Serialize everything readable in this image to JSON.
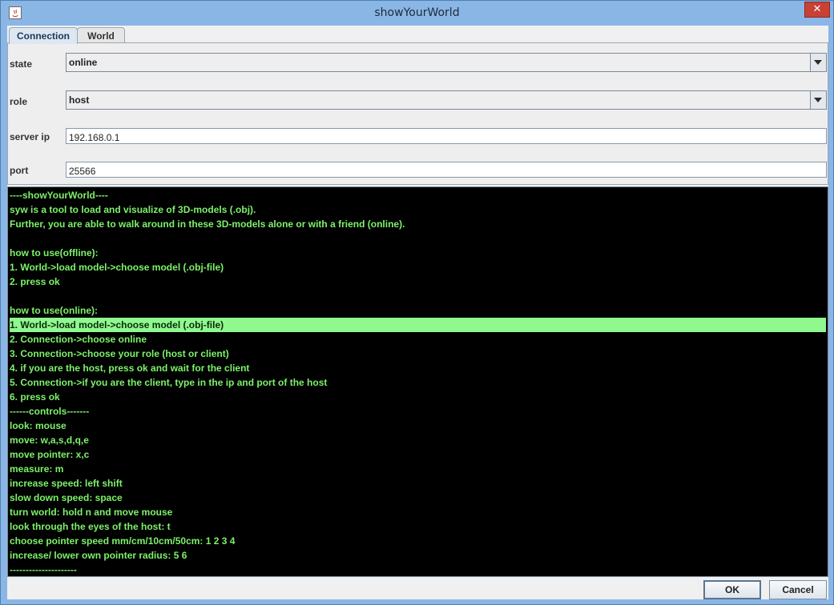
{
  "window": {
    "title": "showYourWorld",
    "close_label": "✕"
  },
  "tabs": [
    {
      "label": "Connection"
    },
    {
      "label": "World"
    }
  ],
  "form": {
    "state": {
      "label": "state",
      "value": "online"
    },
    "role": {
      "label": "role",
      "value": "host"
    },
    "server_ip": {
      "label": "server ip",
      "value": "192.168.0.1"
    },
    "port": {
      "label": "port",
      "value": "25566"
    }
  },
  "console": {
    "text_color": "#7df26a",
    "highlight_color": "#8ff88f",
    "lines": [
      "----showYourWorld----",
      "syw is a tool to load and visualize of 3D-models (.obj).",
      "Further, you are able to walk around in these 3D-models alone or with a friend (online).",
      "",
      "how to use(offline):",
      "1. World->load model->choose model (.obj-file)",
      "2. press ok",
      "",
      "how to use(online):",
      "1. World->load model->choose model (.obj-file)",
      "2. Connection->choose online",
      "3. Connection->choose your role (host or client)",
      "4. if you are the host, press ok and wait for the client",
      "5. Connection->if you are the client, type in the ip and port of the host",
      "6. press ok",
      "------controls-------",
      "look: mouse",
      "move: w,a,s,d,q,e",
      "move pointer: x,c",
      "measure: m",
      "increase speed: left shift",
      "slow down speed: space",
      "turn world: hold n and move mouse",
      "look through the eyes of the host: t",
      "choose pointer speed mm/cm/10cm/50cm: 1 2 3 4",
      "increase/ lower own pointer radius: 5 6",
      "---------------------"
    ],
    "highlighted_line": 9
  },
  "buttons": {
    "ok": "OK",
    "cancel": "Cancel"
  }
}
